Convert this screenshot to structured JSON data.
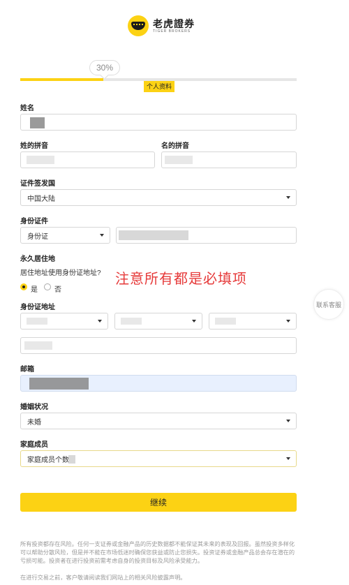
{
  "brand": {
    "name_cn": "老虎證券",
    "name_en": "TIGER BROKERS"
  },
  "progress": {
    "percent_label": "30%",
    "fraction": 0.3,
    "step_label": "个人资料"
  },
  "fields": {
    "name": {
      "label": "姓名"
    },
    "surname_pinyin": {
      "label": "姓的拼音"
    },
    "given_pinyin": {
      "label": "名的拼音"
    },
    "issuing_country": {
      "label": "证件签发国",
      "value": "中国大陆"
    },
    "id_doc": {
      "label": "身份证件",
      "type_value": "身份证"
    },
    "permanent_address": {
      "label": "永久居住地",
      "question": "居住地址使用身份证地址?",
      "yes": "是",
      "no": "否"
    },
    "id_address": {
      "label": "身份证地址"
    },
    "email": {
      "label": "邮箱"
    },
    "marital": {
      "label": "婚姻状况",
      "value": "未婚"
    },
    "family": {
      "label": "家庭成员",
      "value": "家庭成员个数"
    }
  },
  "annotation": "注意所有都是必填项",
  "support_label": "联系客服",
  "continue_label": "继续",
  "disclaimer": {
    "p1": "所有投资都存在风险。任何一支证券或金融产品的历史数据都不能保证其未来的表现及回报。虽然投资多样化可以帮助分散风险，但是并不能在市场低迷时确保您获益或防止您损失。投资证券或金融产品总会存在潜在的亏损可能。投资者在进行投资前需考虑自身的投资目标及风险承受能力。",
    "p2": "在进行交易之前，客户敬请阅读我们网站上的相关风险披露声明。"
  },
  "colors": {
    "accent": "#fcd214",
    "notice": "#e63a3a"
  }
}
